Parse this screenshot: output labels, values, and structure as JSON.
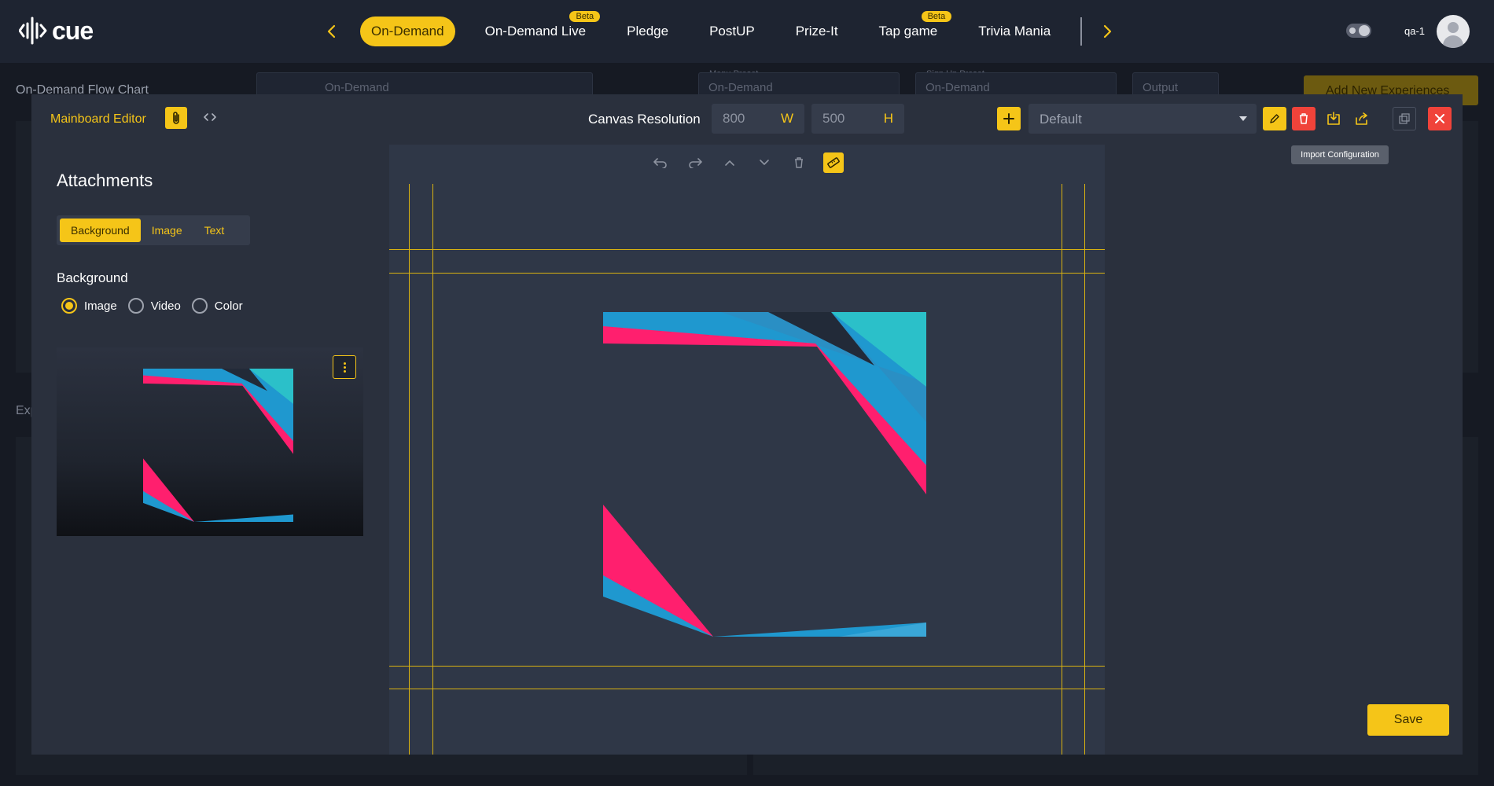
{
  "brand": {
    "name": "cue"
  },
  "nav": {
    "tabs": [
      {
        "label": "On-Demand",
        "active": true,
        "beta": false
      },
      {
        "label": "On-Demand Live",
        "active": false,
        "beta": true
      },
      {
        "label": "Pledge",
        "active": false,
        "beta": false
      },
      {
        "label": "PostUP",
        "active": false,
        "beta": false
      },
      {
        "label": "Prize-It",
        "active": false,
        "beta": false
      },
      {
        "label": "Tap game",
        "active": false,
        "beta": true
      },
      {
        "label": "Trivia Mania",
        "active": false,
        "beta": false
      }
    ],
    "beta_label": "Beta",
    "prev_icon": "chevron-left-icon",
    "next_icon": "chevron-right-icon"
  },
  "user": {
    "name": "qa-1"
  },
  "background_page": {
    "title": "On-Demand Flow Chart",
    "experience_select": "On-Demand",
    "menu_preset_label": "Menu Preset",
    "menu_preset_value": "On-Demand",
    "signup_preset_label": "Sign Up Preset",
    "signup_preset_value": "On-Demand",
    "output_label": "Output",
    "add_button": "Add New Experiences",
    "experiences_label": "Exp"
  },
  "modal": {
    "title": "Mainboard Editor",
    "canvas_resolution_label": "Canvas Resolution",
    "width_value": "800",
    "width_unit": "W",
    "height_value": "500",
    "height_unit": "H",
    "preset_value": "Default",
    "tooltip": "Import Configuration",
    "save_label": "Save"
  },
  "sidebar": {
    "title": "Attachments",
    "tabs": [
      "Background",
      "Image",
      "Text"
    ],
    "active_tab": "Background",
    "section_title": "Background",
    "radio_options": [
      "Image",
      "Video",
      "Color"
    ],
    "selected_option": "Image"
  },
  "colors": {
    "accent": "#f5c518",
    "danger": "#f0433a",
    "modal_bg": "#2a303d",
    "canvas_bg": "#2f3747",
    "frame_pink": "#ff1f6e",
    "frame_blue": "#1f98cf",
    "frame_teal": "#2bc0c9"
  }
}
